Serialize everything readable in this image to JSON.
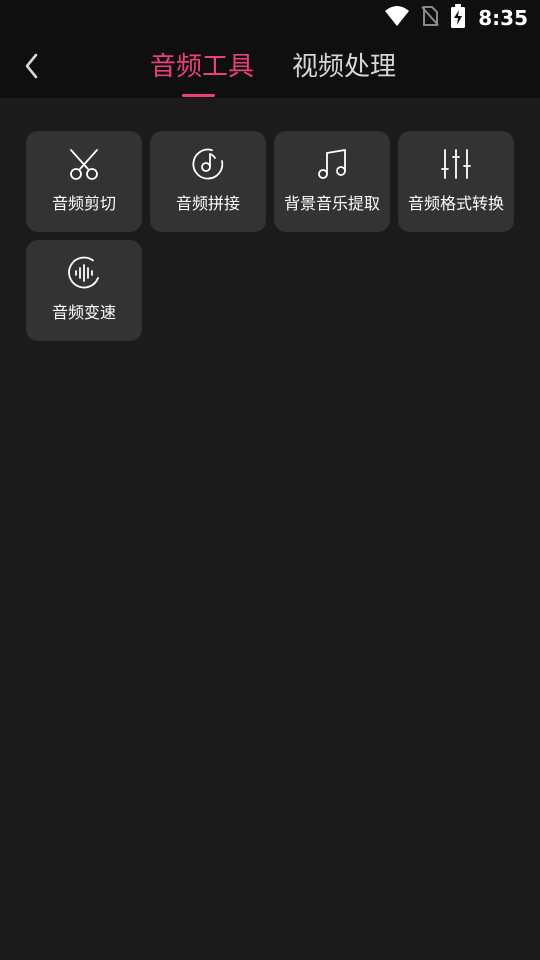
{
  "status_bar": {
    "time": "8:35",
    "icons": [
      "wifi-icon",
      "no-sim-icon",
      "battery-charging-icon"
    ]
  },
  "header": {
    "back_icon": "chevron-left-icon",
    "tabs": [
      {
        "label": "音频工具",
        "active": true
      },
      {
        "label": "视频处理",
        "active": false
      }
    ]
  },
  "colors": {
    "accent": "#ec3f7e",
    "background": "#1b1b1b",
    "card": "#333333",
    "header": "#0f0f0f"
  },
  "tools": [
    {
      "label": "音频剪切",
      "icon": "scissors-icon"
    },
    {
      "label": "音频拼接",
      "icon": "music-disc-icon"
    },
    {
      "label": "背景音乐提取",
      "icon": "music-note-icon"
    },
    {
      "label": "音频格式转换",
      "icon": "equalizer-sliders-icon"
    },
    {
      "label": "音频变速",
      "icon": "waveform-circle-icon"
    }
  ]
}
